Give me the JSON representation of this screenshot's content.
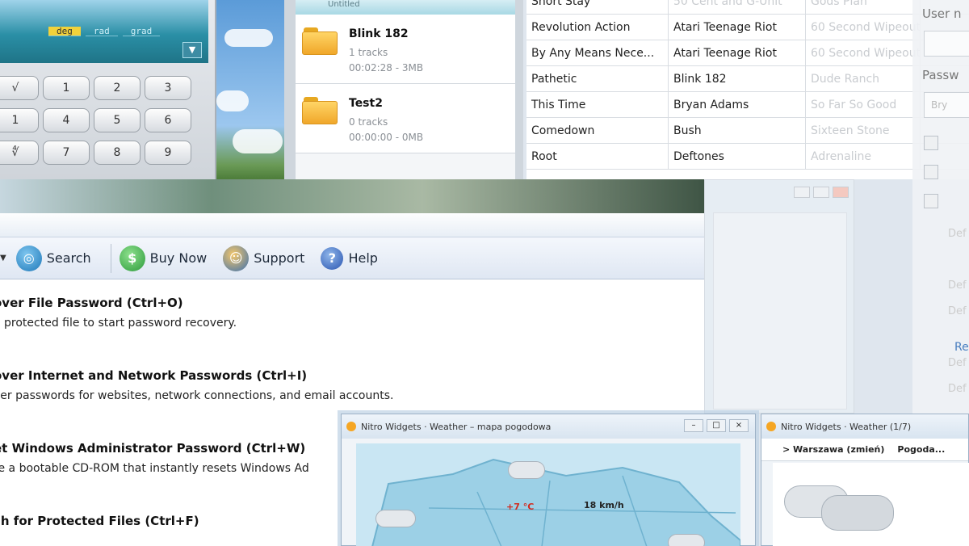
{
  "calculator": {
    "modes": [
      "deg",
      "rad",
      "grad"
    ],
    "active_mode": "deg",
    "keys": [
      "√",
      "1",
      "2",
      "3",
      "1",
      "4",
      "5",
      "6",
      "∜",
      "7",
      "8",
      "9"
    ]
  },
  "playlists": {
    "header": "Untitled",
    "items": [
      {
        "name": "Blink 182",
        "tracks": "1 tracks",
        "info": "00:02:28 - 3MB"
      },
      {
        "name": "Test2",
        "tracks": "0 tracks",
        "info": "00:00:00 - 0MB"
      }
    ]
  },
  "tracks": {
    "rows": [
      {
        "title": "Short Stay",
        "artist": "50 Cent and G-Unit",
        "album": "Gods Plan",
        "extra": ""
      },
      {
        "title": "Revolution Action",
        "artist": "Atari Teenage Riot",
        "album": "60 Second Wipeout",
        "extra": ""
      },
      {
        "title": "By Any Means Nece...",
        "artist": "Atari Teenage Riot",
        "album": "60 Second Wipeout",
        "extra": ""
      },
      {
        "title": "Pathetic",
        "artist": "Blink 182",
        "album": "Dude Ranch",
        "extra": ""
      },
      {
        "title": "This Time",
        "artist": "Bryan Adams",
        "album": "So Far So Good",
        "extra": ""
      },
      {
        "title": "Comedown",
        "artist": "Bush",
        "album": "Sixteen Stone",
        "extra": ""
      },
      {
        "title": "Root",
        "artist": "Deftones",
        "album": "Adrenaline",
        "extra": ""
      }
    ]
  },
  "ghost_form": {
    "username_label": "User n",
    "password_label": "Passw",
    "input_value": "Bry",
    "link": "Re",
    "faded_items": [
      "Def",
      "Def",
      "Def",
      "Def",
      "Def",
      "Def",
      "Def"
    ]
  },
  "password_app": {
    "toolbar": {
      "search": "Search",
      "buy_now": "Buy Now",
      "support": "Support",
      "help": "Help"
    },
    "tasks": [
      {
        "title": "over File Password (Ctrl+O)",
        "desc": "a protected file to start password recovery."
      },
      {
        "title": "over Internet and Network Passwords (Ctrl+I)",
        "desc": "ver passwords for websites, network connections, and email accounts."
      },
      {
        "title": "et Windows Administrator Password (Ctrl+W)",
        "desc": "te a bootable CD-ROM that instantly resets Windows Ad"
      },
      {
        "title": "ch for Protected Files (Ctrl+F)",
        "desc": ""
      }
    ]
  },
  "weather1": {
    "title": "Nitro Widgets · Weather – mapa pogodowa",
    "temp": "+7 °C",
    "wind": "18 km/h"
  },
  "weather2": {
    "title": "Nitro Widgets · Weather (1/7)",
    "location": "> Warszawa (zmień)",
    "tab": "Pogoda..."
  },
  "colors": {
    "accent": "#2a8fa6",
    "folder": "#f0a72a",
    "link": "#4a7fc0"
  }
}
